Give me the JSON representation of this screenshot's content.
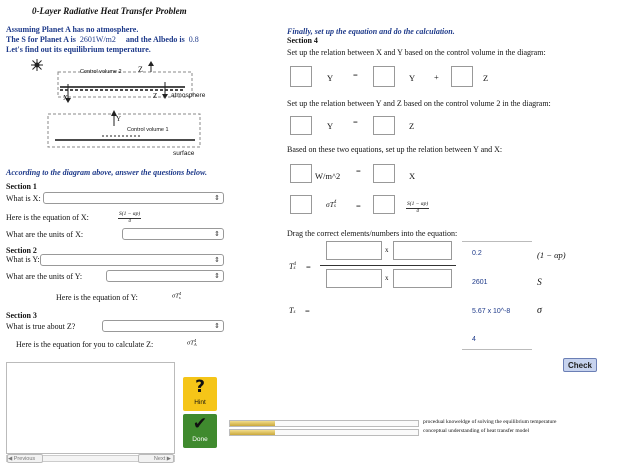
{
  "title": "0-Layer Radiative Heat Transfer Problem",
  "intro": {
    "line1": "Assuming Planet A has no atmosphere.",
    "line2a": "The S for Planet A is",
    "s_value": "2601W/m2",
    "line2b": "and the Albedo is",
    "albedo_value": "0.8",
    "line3": "Let's find out its equilibrium temperature."
  },
  "diagram": {
    "cv2": "Control volume 2",
    "z_top": "Z",
    "x": "X",
    "z_mid": "Z",
    "atmosphere": "atmosphere",
    "y": "Y",
    "cv1": "Control volume 1",
    "surface": "surface"
  },
  "questions_intro": "According to the diagram above, answer the questions below.",
  "section1": {
    "title": "Section 1",
    "q_x": "What is X:",
    "eq_x_label": "Here is the equation of X:",
    "eq_x_num": "S(1 − αp)",
    "eq_x_den": "4",
    "units_x": "What are the units of X:"
  },
  "section2": {
    "title": "Section 2",
    "q_y": "What is Y:",
    "units_y": "What are the units of Y:",
    "eq_y_label": "Here is the equation of Y:",
    "eq_y": "σT",
    "eq_y_sub": "s",
    "eq_y_sup": "4"
  },
  "section3": {
    "title": "Section 3",
    "q_z": "What is true about Z?",
    "eq_z_label": "Here is the equation for you to calculate Z:",
    "eq_z": "σT",
    "eq_z_sub": "A",
    "eq_z_sup": "4"
  },
  "right": {
    "finally": "Finally, set up the equation and do the calculation.",
    "section4": "Section 4",
    "rel_xy": "Set up the relation between X and Y based on the control volume in the diagram:",
    "y1": "Y",
    "eq1": "=",
    "y2": "Y",
    "plus": "+",
    "z1": "Z",
    "rel_yz": "Set up the relation between Y and Z based on the control volume 2 in the diagram:",
    "y3": "Y",
    "eq2": "=",
    "z2": "Z",
    "rel_yx": "Based on these two equations, set up the relation between Y and X:",
    "unit": "W/m^2",
    "eq3": "=",
    "x1": "X",
    "sig": "σT",
    "sig_sub": "s",
    "sig_sup": "4",
    "eq4": "=",
    "frac_num": "S(1 − αp)",
    "frac_den": "4",
    "drag": "Drag the correct elements/numbers into the equation:",
    "ts4": "T",
    "ts4_sub": "s",
    "ts4_sup": "4",
    "eq5": "=",
    "times1": "x",
    "times2": "x",
    "ts": "T",
    "ts_sub": "s",
    "eq6": "="
  },
  "tiles": {
    "t1": "0.2",
    "t2": "2601",
    "t3": "5.67 x 10^-8",
    "t4": "4",
    "s1": "(1 − αp)",
    "s2": "S",
    "s3": "σ"
  },
  "check": "Check",
  "hint": "Hint",
  "done": "Done",
  "hint_glyph": "?",
  "done_glyph": "✔",
  "progress": [
    {
      "label": "procedual knoweldge of solving the equilibrium temperature",
      "fraction": 0.24
    },
    {
      "label": "conceptual understanding of heat transfer model",
      "fraction": 0.24
    }
  ],
  "nav": {
    "prev": "◀ Previous",
    "next": "Next ▶"
  },
  "colors": {
    "hint_bg": "#f5c518",
    "done_bg": "#3f8a2e",
    "blue": "#1e3a8a"
  }
}
